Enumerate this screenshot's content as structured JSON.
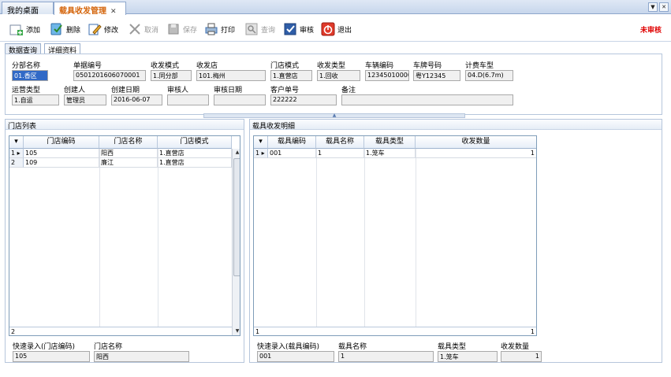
{
  "tabs": {
    "desktop": "我的桌面",
    "current": "载具收发管理",
    "close_glyph": "✕"
  },
  "toolbar": {
    "add": "添加",
    "delete": "删除",
    "edit": "修改",
    "cancel": "取消",
    "save": "保存",
    "print": "打印",
    "query": "查询",
    "audit": "审核",
    "exit": "退出",
    "status": "未审核"
  },
  "subtabs": {
    "data_query": "数据查询",
    "detail": "详细资料"
  },
  "form": {
    "branch_name_label": "分部名称",
    "branch_name": "01.香区",
    "doc_no_label": "单据编号",
    "doc_no": "0501201606070001",
    "send_mode_label": "收发模式",
    "send_mode": "1.同分部",
    "send_store_label": "收发店",
    "send_store": "101.梅州",
    "store_mode_label": "门店模式",
    "store_mode": "1.直营店",
    "send_type_label": "收发类型",
    "send_type": "1.回收",
    "vehicle_code_label": "车辆编码",
    "vehicle_code": "12345010000",
    "plate_label": "车牌号码",
    "plate": "粤Y12345",
    "fee_vehicle_label": "计费车型",
    "fee_vehicle": "04.D(6.7m)",
    "op_type_label": "运营类型",
    "op_type": "1.自运",
    "creator_label": "创建人",
    "creator": "管理员",
    "create_date_label": "创建日期",
    "create_date": "2016-06-07",
    "auditor_label": "审核人",
    "auditor": "",
    "audit_date_label": "审核日期",
    "audit_date": "",
    "customer_no_label": "客户单号",
    "customer_no": "222222",
    "remark_label": "备注",
    "remark": ""
  },
  "store_list": {
    "title": "门店列表",
    "columns": [
      "门店编码",
      "门店名称",
      "门店模式"
    ],
    "rows": [
      {
        "index": "1",
        "code": "105",
        "name": "阳西",
        "mode": "1.直营店"
      },
      {
        "index": "2",
        "code": "109",
        "name": "廉江",
        "mode": "1.直营店"
      }
    ],
    "footer_count": "2",
    "quick_code_label": "快速录入(门店编码)",
    "quick_code": "105",
    "quick_name_label": "门店名称",
    "quick_name": "阳西"
  },
  "carrier_detail": {
    "title": "载具收发明细",
    "columns": [
      "载具编码",
      "载具名称",
      "载具类型",
      "收发数量"
    ],
    "rows": [
      {
        "index": "1",
        "code": "001",
        "name": "1",
        "type": "1.笼车",
        "qty": "1"
      }
    ],
    "footer_count": "1",
    "footer_qty": "1",
    "quick_code_label": "快速录入(载具编码)",
    "quick_code": "001",
    "quick_name_label": "载具名称",
    "quick_name": "1",
    "quick_type_label": "载具类型",
    "quick_type": "1.笼车",
    "quick_qty_label": "收发数量",
    "quick_qty": "1"
  }
}
